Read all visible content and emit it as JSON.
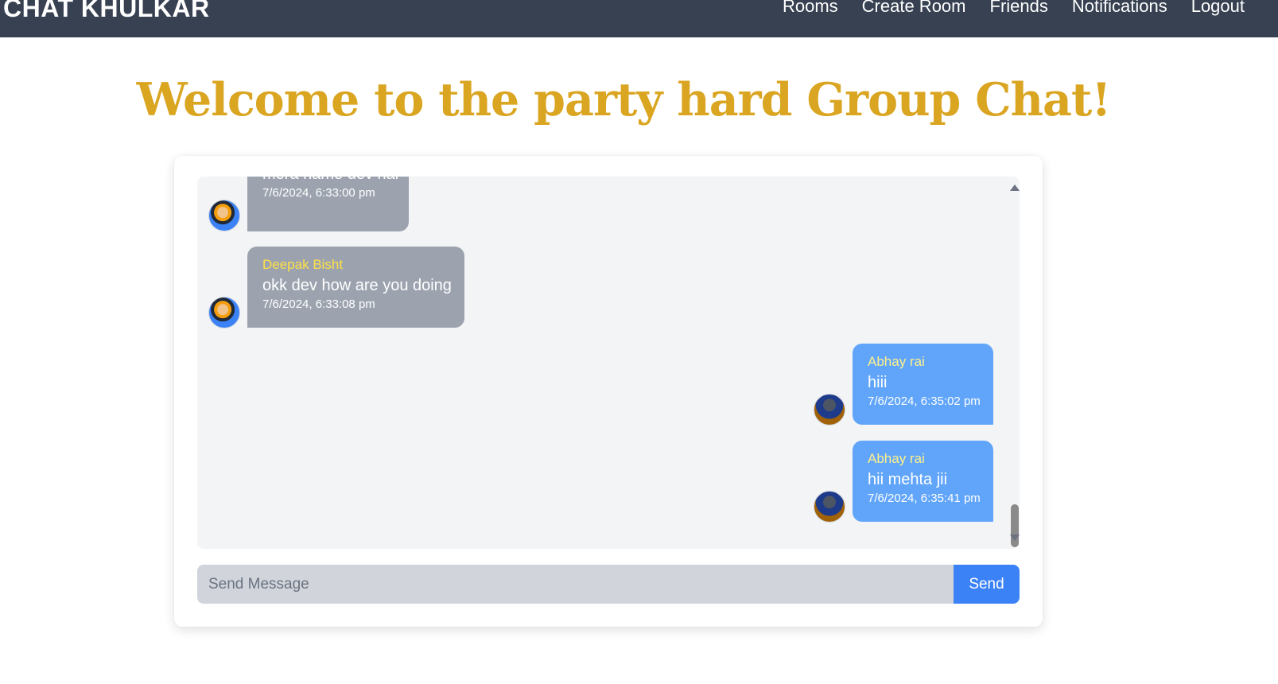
{
  "navbar": {
    "brand": "CHAT KHULKAR",
    "links": [
      "Rooms",
      "Create Room",
      "Friends",
      "Notifications",
      "Logout"
    ]
  },
  "page_title": "Welcome to the party hard Group Chat!",
  "messages": [
    {
      "sender": "",
      "text": "mera name dev hai",
      "time": "7/6/2024, 6:33:00 pm",
      "side": "left"
    },
    {
      "sender": "Deepak Bisht",
      "text": "okk dev how are you doing",
      "time": "7/6/2024, 6:33:08 pm",
      "side": "left"
    },
    {
      "sender": "Abhay rai",
      "text": "hiii",
      "time": "7/6/2024, 6:35:02 pm",
      "side": "right"
    },
    {
      "sender": "Abhay rai",
      "text": "hii mehta jii",
      "time": "7/6/2024, 6:35:41 pm",
      "side": "right"
    }
  ],
  "composer": {
    "placeholder": "Send Message",
    "value": "",
    "send_label": "Send"
  },
  "colors": {
    "navbar": "#374151",
    "title": "#daa520",
    "bubble_other": "#9ca3af",
    "bubble_self": "#60a5fa",
    "sender_name": "#fde047",
    "send_button": "#3b82f6"
  },
  "icons": {
    "avatar_other": "naruto-avatar",
    "avatar_self": "user-photo-avatar"
  }
}
